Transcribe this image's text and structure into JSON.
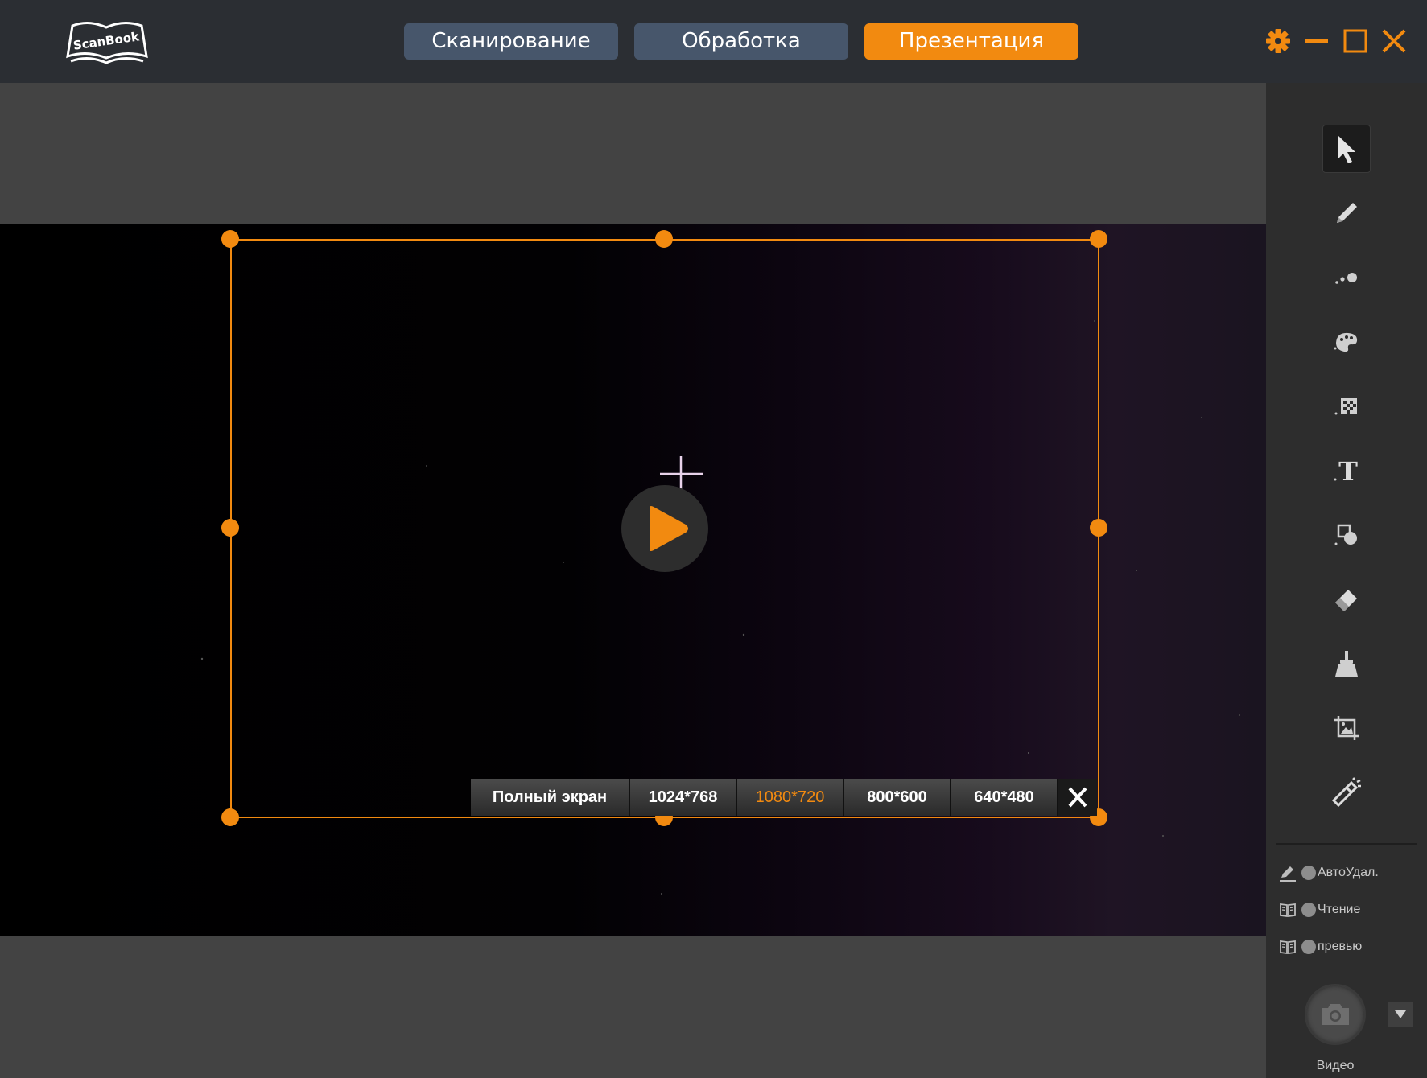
{
  "app": {
    "logo_text": "ScanBook"
  },
  "tabs": [
    {
      "label": "Сканирование"
    },
    {
      "label": "Обработка"
    },
    {
      "label": "Презентация"
    }
  ],
  "active_tab": "Презентация",
  "window_controls": [
    "gear-icon",
    "minimize-icon",
    "maximize-icon",
    "close-icon"
  ],
  "resolutions": [
    {
      "label": "Полный экран"
    },
    {
      "label": "1024*768"
    },
    {
      "label": "1080*720"
    },
    {
      "label": "800*600"
    },
    {
      "label": "640*480"
    }
  ],
  "active_resolution": "1080*720",
  "tools": [
    "pointer-icon",
    "pen-icon",
    "dots-icon",
    "palette-icon",
    "mosaic-icon",
    "text-icon",
    "shapes-icon",
    "eraser-icon",
    "broom-icon",
    "crop-image-icon",
    "highlighter-icon"
  ],
  "toggles": [
    {
      "label": "АвтоУдал."
    },
    {
      "label": "Чтение"
    },
    {
      "label": "превью"
    }
  ],
  "capture": {
    "label": "Видео"
  },
  "colors": {
    "accent": "#f28a10",
    "tab": "#47566b",
    "header": "#2b2e33",
    "sidebar": "#2d2d2d"
  }
}
